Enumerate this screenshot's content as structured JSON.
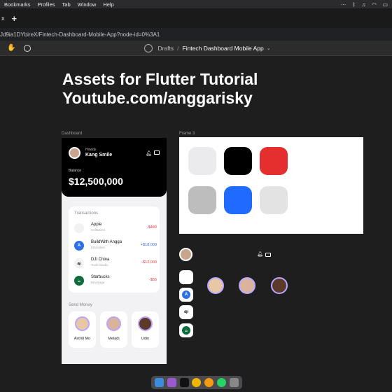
{
  "menubar": {
    "items": [
      "Bookmarks",
      "Profiles",
      "Tab",
      "Window",
      "Help"
    ]
  },
  "tabbar": {
    "tab_close": "x",
    "new_tab": "+"
  },
  "url": "Jd9ia1DYbireX/Fintech-Dashboard-Mobile-App?node-id=0%3A1",
  "toolbar": {
    "breadcrumb_root": "Drafts",
    "separator": "/",
    "file_name": "Fintech Dashboard Mobile App",
    "chevron": "⌄"
  },
  "canvas": {
    "title_line1": "Assets for Flutter Tutorial",
    "title_line2": "Youtube.com/anggarisky",
    "frame_dashboard_label": "Dashboard",
    "frame3_label": "Frame 3"
  },
  "dashboard": {
    "greeting": "Howdy",
    "user_name": "Kang Smile",
    "balance_label": "Balance",
    "balance_value": "$12,500,000",
    "transactions_title": "Transactions",
    "transactions": [
      {
        "name": "Apple",
        "sub": "Softwares",
        "amount": "-$480",
        "icon": ""
      },
      {
        "name": "BuildWith Angga",
        "sub": "Education",
        "amount": "+$18,000",
        "icon": "A"
      },
      {
        "name": "DJI China",
        "sub": "Tools Studio",
        "amount": "-$12,000",
        "icon": "dji"
      },
      {
        "name": "Starbucks",
        "sub": "Beverage",
        "amount": "-$55",
        "icon": "☕"
      }
    ],
    "send_money_title": "Send Money",
    "contacts": [
      {
        "name": "Astrid Mo"
      },
      {
        "name": "Meladi"
      },
      {
        "name": "Udin"
      }
    ]
  },
  "colors": {
    "amount_negative": "#e0393e",
    "amount_positive": "#2f6fe8",
    "swatches": [
      "#ebebed",
      "#000000",
      "#e52e2e",
      "#bdbdbd",
      "#1f6bff",
      "#e3e3e3"
    ]
  },
  "assets": {
    "icons": [
      "",
      "A",
      "dji",
      "☕"
    ]
  },
  "dock": {
    "apps": [
      "finder",
      "podcasts",
      "appletv",
      "chrome",
      "photos",
      "whatsapp",
      "trash"
    ]
  }
}
